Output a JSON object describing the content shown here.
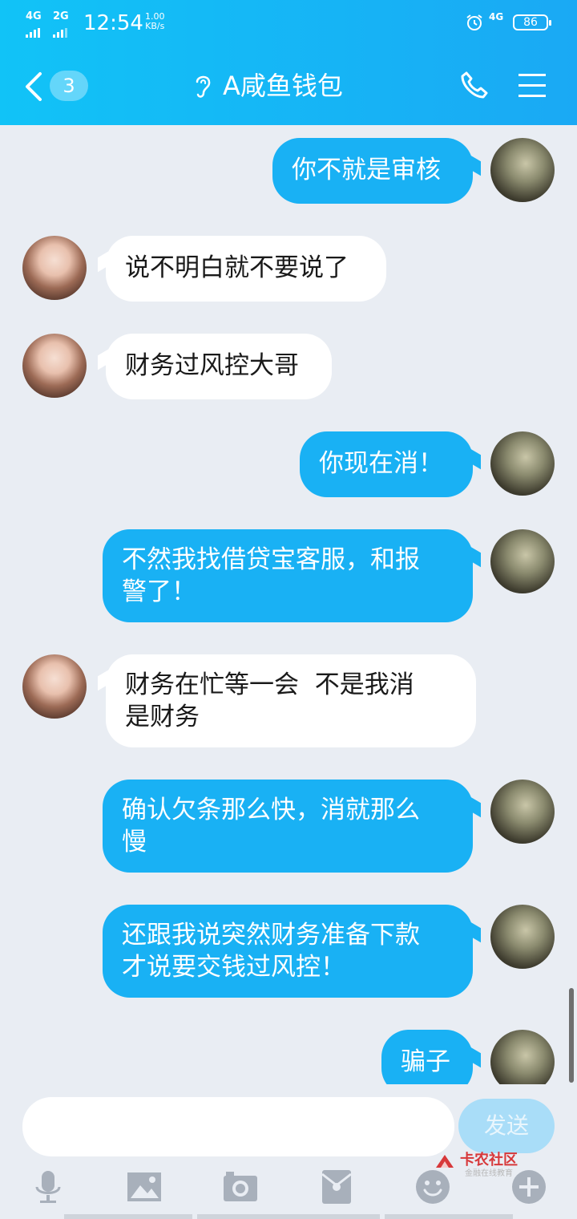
{
  "status_bar": {
    "sig1": "4G",
    "sig2": "2G",
    "time": "12:54",
    "speed_value": "1.00",
    "speed_unit": "KB/s",
    "net": "4G",
    "battery": "86"
  },
  "header": {
    "unread_count": "3",
    "title": "A咸鱼钱包"
  },
  "messages": [
    {
      "from": "self",
      "text": "你不就是审核"
    },
    {
      "from": "other",
      "text": "说不明白就不要说了"
    },
    {
      "from": "other",
      "text": "财务过风控大哥"
    },
    {
      "from": "self",
      "text": "你现在消！"
    },
    {
      "from": "self",
      "line1": "不然我找借贷宝客服，和报",
      "line2": "警了！"
    },
    {
      "from": "other",
      "line1": "财务在忙等一会  不是我消",
      "line2": "是财务"
    },
    {
      "from": "self",
      "line1": "确认欠条那么快，消就那么",
      "line2": "慢"
    },
    {
      "from": "self",
      "line1": "还跟我说突然财务准备下款",
      "line2": "才说要交钱过风控！"
    },
    {
      "from": "self",
      "text": "骗子"
    }
  ],
  "composer": {
    "input_value": "",
    "send_label": "发送"
  },
  "watermark": {
    "title": "卡农社区",
    "subtitle": "金融在线教育"
  },
  "toolbar": [
    "microphone-icon",
    "image-icon",
    "camera-icon",
    "red-packet-icon",
    "emoji-icon",
    "plus-icon"
  ],
  "colors": {
    "header_gradient_start": "#11c3f7",
    "header_gradient_end": "#1aa9f4",
    "self_bubble": "#19b1f4",
    "other_bubble": "#ffffff",
    "background": "#e9edf3"
  }
}
